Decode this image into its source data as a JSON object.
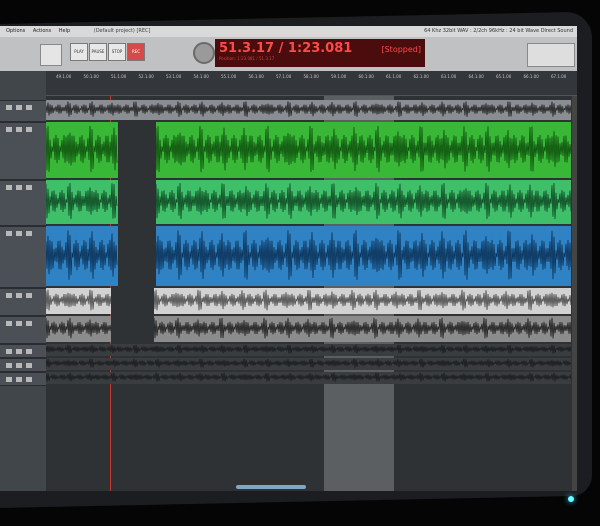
{
  "menu": {
    "items": [
      "Options",
      "Actions",
      "Help"
    ],
    "project": "(Default project) [REC]",
    "status": "64 Khz 32bit WAV : 2/2ch 96kHz : 24 bit Wave Direct Sound"
  },
  "transport": {
    "play": "PLAY",
    "pause": "PAUSE",
    "stop": "STOP",
    "rec": "REC",
    "time": "51.3.17 / 1:23.081",
    "time_sub": "Position: 1:23.081 / 51.3.17",
    "state": "[Stopped]"
  },
  "ruler": {
    "ticks": [
      "49.1.00",
      "50.1.00",
      "51.1.00",
      "52.1.00",
      "53.1.00",
      "54.1.00",
      "55.1.00",
      "56.1.00",
      "57.1.00",
      "58.1.00",
      "59.1.00",
      "60.1.00",
      "61.1.00",
      "62.1.00",
      "63.1.00",
      "64.1.00",
      "65.1.00",
      "66.1.00",
      "67.1.00"
    ]
  },
  "tracks": [
    {
      "color": "#8a8d91",
      "wave": "#1e1e1e",
      "height": 22
    },
    {
      "color": "#39b837",
      "wave": "#0d4d0d",
      "height": 58
    },
    {
      "color": "#3fbf6a",
      "wave": "#0c4420",
      "height": 46
    },
    {
      "color": "#2f83c4",
      "wave": "#0a2e52",
      "height": 62
    },
    {
      "color": "#d2d2d2",
      "wave": "#444",
      "height": 28
    },
    {
      "color": "#8c8c8c",
      "wave": "#1a1a1a",
      "height": 28
    },
    {
      "color": "#3a3d40",
      "wave": "#1a1c1e",
      "height": 14
    },
    {
      "color": "#3a3d40",
      "wave": "#1a1c1e",
      "height": 14
    },
    {
      "color": "#3a3d40",
      "wave": "#1a1c1e",
      "height": 14
    }
  ]
}
